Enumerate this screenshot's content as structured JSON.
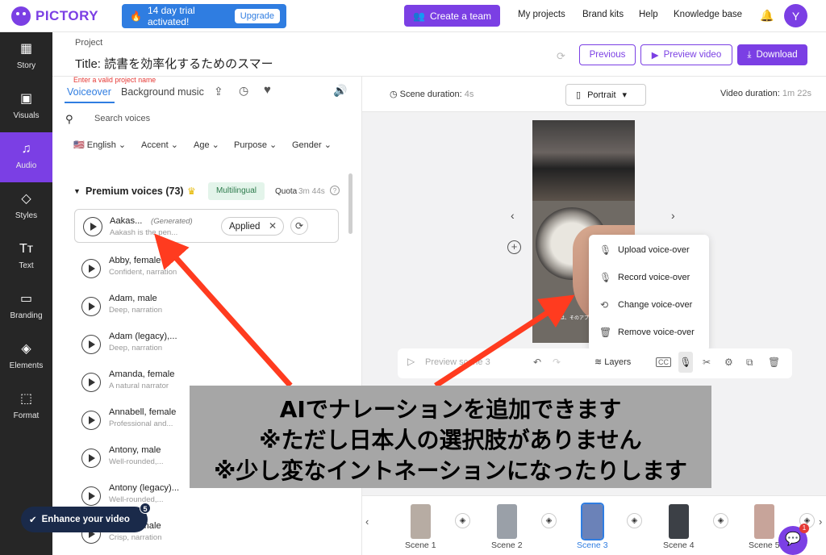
{
  "app": {
    "brand": "PICTORY"
  },
  "topbar": {
    "trial_text": "14 day trial activated!",
    "upgrade_label": "Upgrade",
    "create_team_label": "Create a team",
    "nav": [
      "My projects",
      "Brand kits",
      "Help",
      "Knowledge base"
    ],
    "avatar_initial": "Y"
  },
  "sidebar": {
    "items": [
      {
        "label": "Story",
        "icon": "story-icon"
      },
      {
        "label": "Visuals",
        "icon": "image-icon"
      },
      {
        "label": "Audio",
        "icon": "music-icon",
        "active": true
      },
      {
        "label": "Styles",
        "icon": "styles-icon"
      },
      {
        "label": "Text",
        "icon": "text-icon"
      },
      {
        "label": "Branding",
        "icon": "briefcase-icon"
      },
      {
        "label": "Elements",
        "icon": "elements-icon"
      },
      {
        "label": "Format",
        "icon": "format-icon"
      }
    ]
  },
  "header": {
    "project_label": "Project",
    "title": "Title: 読書を効率化するためのスマー",
    "error": "Enter a valid project name",
    "previous_label": "Previous",
    "preview_label": "Preview video",
    "download_label": "Download"
  },
  "audio_panel": {
    "tabs": [
      "Voiceover",
      "Background music"
    ],
    "search_placeholder": "Search voices",
    "filters": [
      "English",
      "Accent",
      "Age",
      "Purpose",
      "Gender"
    ],
    "section_title": "Premium voices (73)",
    "multilingual_label": "Multilingual",
    "quota_label": "Quota",
    "quota_value": "3m 44s",
    "selected_voice": {
      "name": "Aakas...",
      "tag": "(Generated)",
      "desc": "Aakash is the pen...",
      "applied_label": "Applied"
    },
    "voices": [
      {
        "name": "Abby, female",
        "desc": "Confident, narration"
      },
      {
        "name": "Adam, male",
        "desc": "Deep, narration"
      },
      {
        "name": "Adam (legacy),...",
        "desc": "Deep, narration"
      },
      {
        "name": "Amanda, female",
        "desc": "A natural narrator"
      },
      {
        "name": "Annabell, female",
        "desc": "Professional and..."
      },
      {
        "name": "Antony, male",
        "desc": "Well-rounded,..."
      },
      {
        "name": "Antony (legacy)...",
        "desc": "Well-rounded,..."
      },
      {
        "name": "...rnold, male",
        "desc": "Crisp, narration"
      }
    ],
    "enhance_label": "Enhance your video",
    "enhance_badge": "5"
  },
  "stage": {
    "scene_duration_label": "Scene duration:",
    "scene_duration_value": "4s",
    "orientation": "Portrait",
    "video_duration_label": "Video duration:",
    "video_duration_value": "1m 22s",
    "caption": "は、そのアプリの機能を紹介",
    "menu": [
      {
        "label": "Upload voice-over",
        "icon": "upload-mic-icon"
      },
      {
        "label": "Record voice-over",
        "icon": "record-mic-icon"
      },
      {
        "label": "Change voice-over",
        "icon": "change-voice-icon"
      },
      {
        "label": "Remove voice-over",
        "icon": "trash-icon"
      }
    ],
    "preview_scene_label": "Preview scene 3",
    "layers_label": "Layers",
    "scenes": [
      "Scene 1",
      "Scene 2",
      "Scene 3",
      "Scene 4",
      "Scene 5"
    ],
    "selected_scene": "Scene 3",
    "chat_badge": "1"
  },
  "annotation": {
    "lines": [
      "AIでナレーションを追加できます",
      "※ただし日本人の選択肢がありません",
      "※少し変なイントネーションになったりします"
    ],
    "arrow_color": "#ff3b1f"
  },
  "colors": {
    "brand": "#7b3fe4",
    "trial": "#2f7de1",
    "rail": "#262626",
    "selected": "#2f7de1"
  }
}
